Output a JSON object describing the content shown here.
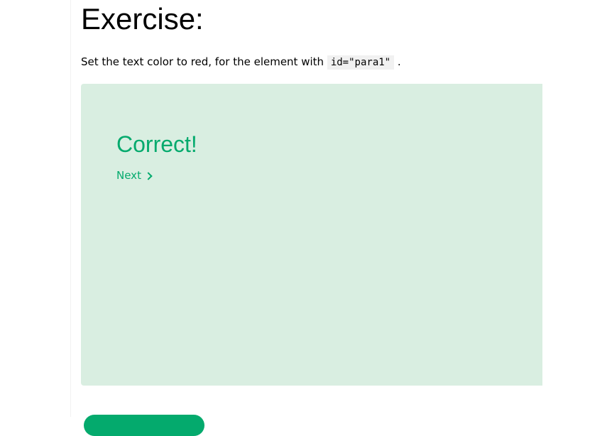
{
  "exercise": {
    "heading": "Exercise:",
    "instruction_before": "Set the text color to red, for the element with",
    "instruction_code": "id=\"para1\"",
    "instruction_after": "."
  },
  "result": {
    "title": "Correct!",
    "next_label": "Next"
  },
  "icons": {
    "next": "chevron-right-icon"
  },
  "colors": {
    "success": "#04aa6d",
    "panel_background": "#d9eee1",
    "code_background": "#f1f1f1"
  }
}
